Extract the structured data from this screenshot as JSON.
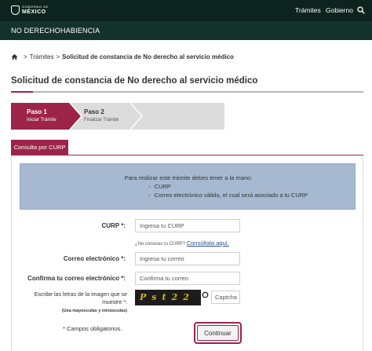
{
  "header": {
    "logo_small": "GOBIERNO DE",
    "logo_big": "MÉXICO",
    "nav": [
      "Trámites",
      "Gobierno"
    ],
    "search_icon": "search-icon"
  },
  "subheader": {
    "title": "NO DERECHOHABIENCIA"
  },
  "breadcrumb": {
    "home_icon": "home-icon",
    "link": "Trámites",
    "separator": ">",
    "current": "Solicitud de constancia de No derecho al servicio médico"
  },
  "page": {
    "title": "Solicitud de constancia de No derecho al servicio médico"
  },
  "steps": [
    {
      "label": "Paso 1",
      "sub": "Iniciar Trámite",
      "active": true
    },
    {
      "label": "Paso 2",
      "sub": "Finalizar Trámite",
      "active": false
    }
  ],
  "tab": {
    "label": "Consulta por CURP"
  },
  "info": {
    "intro": "Para realizar este trámite debes tener a la mano:",
    "items": [
      "CURP",
      "Correo electrónico válido, el cual será asociado a tu CURP"
    ]
  },
  "form": {
    "curp": {
      "label": "CURP *:",
      "placeholder": "Ingresa tu CURP",
      "value": ""
    },
    "curp_hint": {
      "text": "¿No conoces tu CURP?",
      "link": "Consúltala aquí."
    },
    "email": {
      "label": "Correo electrónico *:",
      "placeholder": "Ingresa tu correo",
      "value": ""
    },
    "email_confirm": {
      "label": "Confirma tu correo electrónico *:",
      "placeholder": "Confirma tu correo",
      "value": ""
    },
    "captcha": {
      "label": "Escribe las letras de la imagen que se muestre *:",
      "label_note": "(Usa mayúsculas y minúsculas)",
      "image_text": "Pst22",
      "placeholder": "Captcha",
      "value": "",
      "refresh_icon": "refresh-icon"
    },
    "required_note": "* Campos obligatorios.",
    "submit": "Continuar"
  },
  "colors": {
    "header_bg": "#0c231e",
    "subheader_bg": "#13322b",
    "accent": "#9d2449",
    "info_bg": "#a6b9d0",
    "step_inactive": "#dcdcdc"
  }
}
